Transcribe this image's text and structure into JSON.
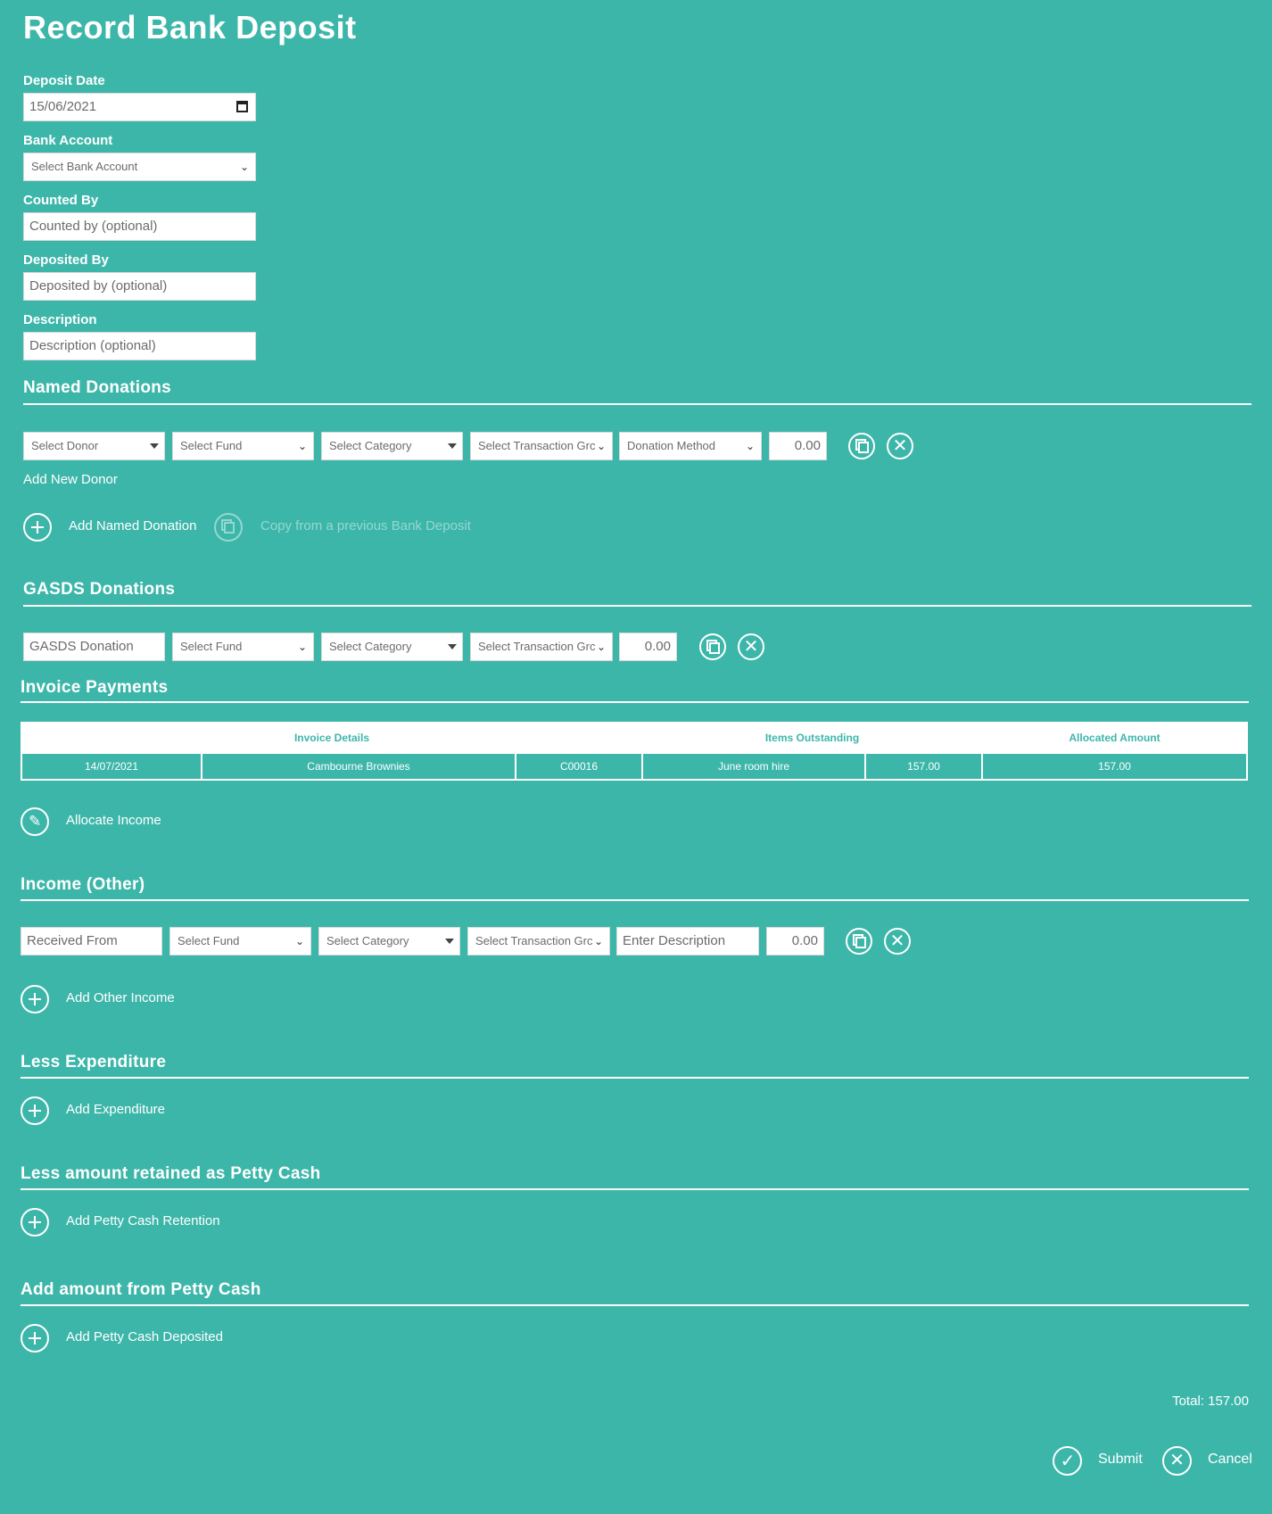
{
  "title": "Record Bank Deposit",
  "deposit": {
    "deposit_date_label": "Deposit Date",
    "deposit_date_value": "15/06/2021",
    "bank_account_label": "Bank Account",
    "bank_account_placeholder": "Select Bank Account",
    "counted_by_label": "Counted By",
    "counted_by_placeholder": "Counted by (optional)",
    "deposited_by_label": "Deposited By",
    "deposited_by_placeholder": "Deposited by (optional)",
    "description_label": "Description",
    "description_placeholder": "Description (optional)"
  },
  "named_donations": {
    "title": "Named Donations",
    "row": {
      "donor": "Select Donor",
      "fund": "Select Fund",
      "category": "Select Category",
      "transaction_group": "Select Transaction Grc",
      "method": "Donation Method",
      "amount": "0.00"
    },
    "add_new_donor": "Add New Donor",
    "add_named_donation": "Add Named Donation",
    "copy_previous": "Copy from a previous Bank Deposit"
  },
  "gasds": {
    "title": "GASDS Donations",
    "row": {
      "name": "GASDS Donation",
      "fund": "Select Fund",
      "category": "Select Category",
      "transaction_group": "Select Transaction Grc",
      "amount": "0.00"
    }
  },
  "invoice_payments": {
    "title": "Invoice Payments",
    "headers": [
      "Invoice Details",
      "Items Outstanding",
      "Allocated Amount"
    ],
    "rows": [
      [
        "14/07/2021",
        "Cambourne Brownies",
        "C00016",
        "June room hire",
        "157.00",
        "157.00"
      ]
    ],
    "allocate_income": "Allocate Income"
  },
  "income_other": {
    "title": "Income (Other)",
    "row": {
      "received_from": "Received From",
      "fund": "Select Fund",
      "category": "Select Category",
      "transaction_group": "Select Transaction Grc",
      "description": "Enter Description",
      "amount": "0.00"
    },
    "add_other_income": "Add Other Income"
  },
  "less_expenditure": {
    "title": "Less Expenditure",
    "add": "Add Expenditure"
  },
  "petty_cash_retained": {
    "title": "Less amount retained as Petty Cash",
    "add": "Add Petty Cash Retention"
  },
  "petty_cash_added": {
    "title": "Add amount from Petty Cash",
    "add": "Add Petty Cash Deposited"
  },
  "footer": {
    "total": "Total: 157.00",
    "submit": "Submit",
    "cancel": "Cancel"
  },
  "colors": {
    "background": "#3db6aa",
    "text": "#ffffff",
    "header_text": "#3db6aa"
  }
}
